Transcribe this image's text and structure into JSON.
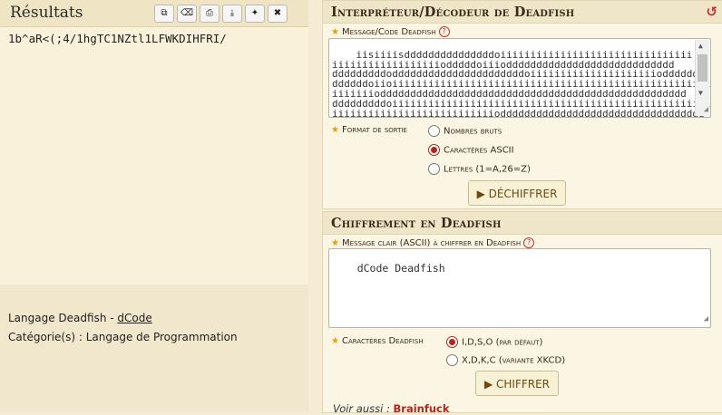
{
  "results": {
    "title": "Résultats",
    "output": "1b^aR<(;4/1hgTC1NZtl1LFWKDIHFRI/",
    "toolbar": {
      "copy": "copy-icon",
      "clear": "clear-icon",
      "print": "print-icon",
      "download": "download-icon",
      "pin": "pin-icon",
      "close": "close-icon"
    },
    "lang_prefix": "Langage Deadfish - ",
    "lang_link": "dCode",
    "category_prefix": "Catégorie(s) : ",
    "category_value": "Langage de Programmation"
  },
  "decoder": {
    "title": "Interpréteur/Décodeur de Deadfish",
    "message_label": "Message/Code Deadfish",
    "code_text": "iisiiiisdddddddddddddddoiiiiiiiiiiiiiiiiiiiiiiiiiiiiiiii\niiiiiiiiiiiiiiiiiiodddddoiiiodddddddddddddddddddddddddddd\ndddddddddoddddddddddddddddddddddoiiiiiiiiiiiiiiiiiiiiioddddddd\nddddddoiioiiiiiiiiiiiiiiiiiiiiiiiiiiiiiiiiiiiiiiiiiiiiiiiiiiiiiii\niiiiiiioddddddddddddddddddddddddddddddddddddddddddddddddddd\ndddddddddoiiiiiiiiiiiiiiiiiiiiiiiiiiiiiiiiiiiiiiiiiiiiiiiiiiiiiii\niiiiiiiiiiiiiiiiiiiiiiiiiiiodddddddddddddddddddddddddddddddddd\nddddddddddddddddddddddddddddddddddddddddoiiiiiiiiiiiiiiiiiiiiii",
    "format_label": "Format de sortie",
    "format_options": [
      "Nombres bruts",
      "Caractères ASCII",
      "Lettres (1=A,26=Z)"
    ],
    "format_selected": 1,
    "decode_button": "▶ DÉCHIFFRER"
  },
  "encoder": {
    "title": "Chiffrement en Deadfish",
    "message_label": "Message clair (ASCII) à chiffrer en Deadfish",
    "plain_text": "dCode Deadfish",
    "chars_label": "Caractères Deadfish",
    "char_options": [
      "I,D,S,O (par défaut)",
      "X,D,K,C (variante XKCD)"
    ],
    "char_selected": 0,
    "encode_button": "▶ CHIFFRER",
    "see_also_prefix": "Voir aussi : ",
    "see_also_link": "Brainfuck"
  },
  "icons": {
    "reload": "reload-icon",
    "help": "help-icon",
    "star": "star-icon",
    "resize": "resize-grip-icon"
  },
  "colors": {
    "accent": "#b3261e",
    "panel": "#f9f1d9",
    "title": "#3b2a1a",
    "button_text": "#6a4a10"
  }
}
